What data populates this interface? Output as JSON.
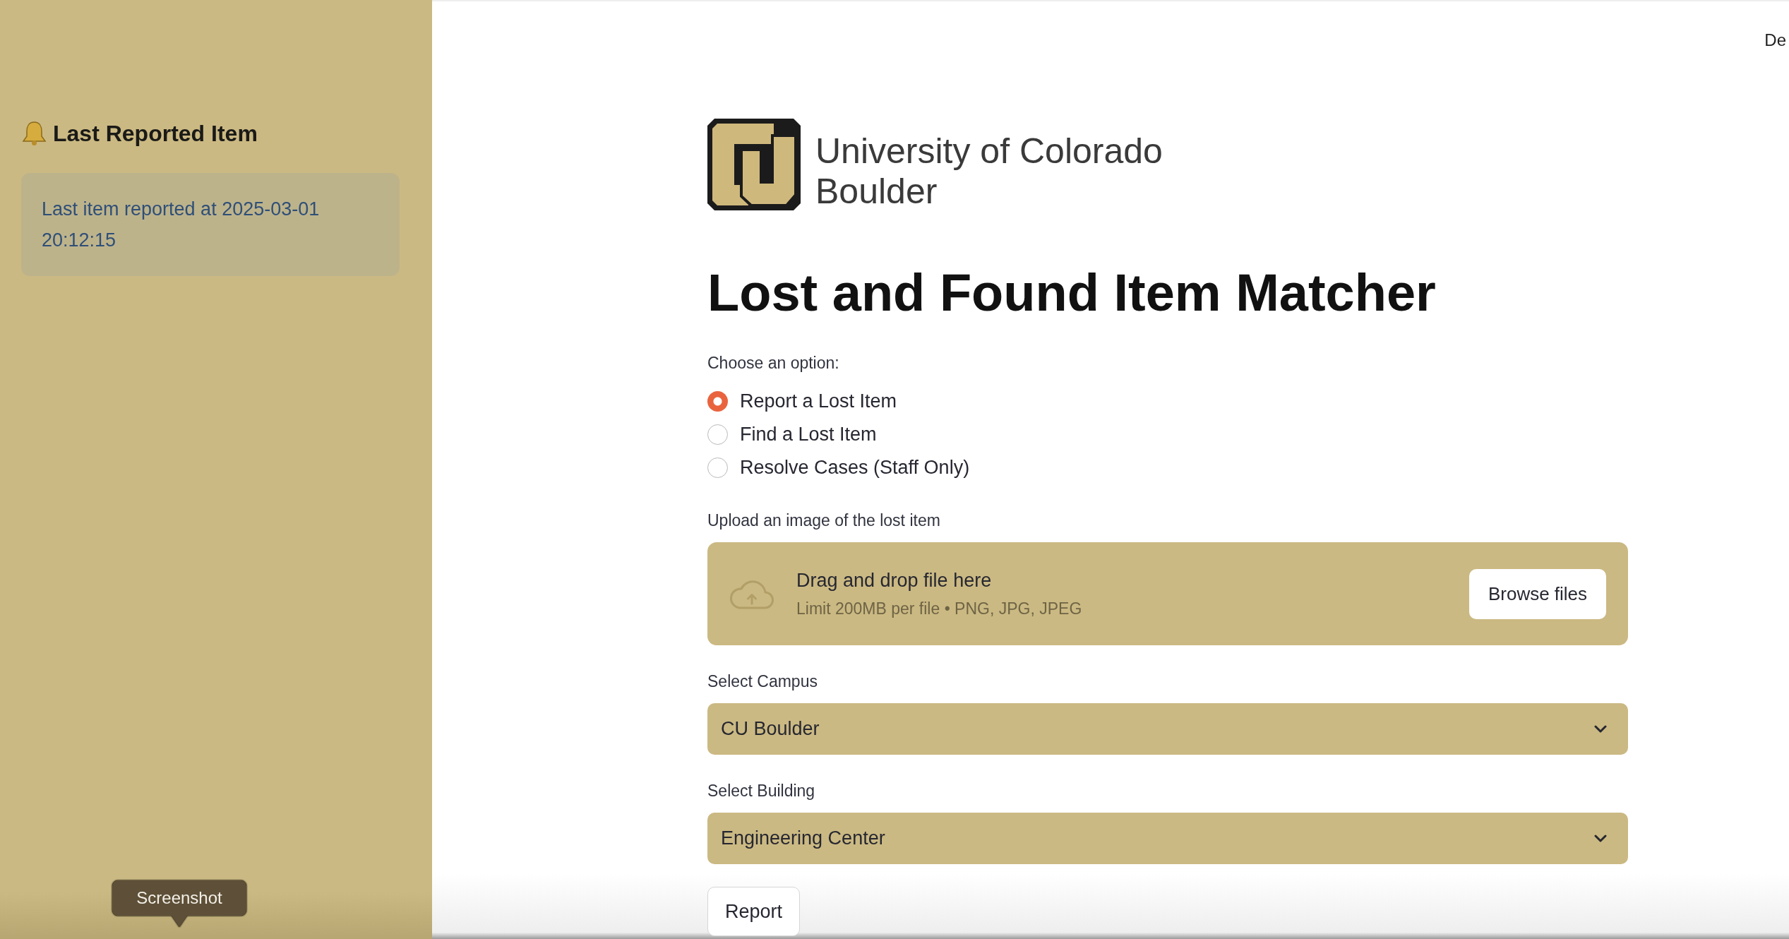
{
  "sidebar": {
    "title": "Last Reported Item",
    "info": "Last item reported at 2025-03-01 20:12:15"
  },
  "header": {
    "action_text": "De"
  },
  "logo": {
    "line_1": "University of Colorado",
    "line_2": "Boulder"
  },
  "title": "Lost and Found Item Matcher",
  "option_group": {
    "label": "Choose an option:",
    "options": [
      {
        "label": "Report a Lost Item",
        "selected": true
      },
      {
        "label": "Find a Lost Item",
        "selected": false
      },
      {
        "label": "Resolve Cases (Staff Only)",
        "selected": false
      }
    ]
  },
  "uploader": {
    "label": "Upload an image of the lost item",
    "prompt": "Drag and drop file here",
    "hint": "Limit 200MB per file • PNG, JPG, JPEG",
    "button": "Browse files"
  },
  "selects": [
    {
      "label": "Select Campus",
      "value": "CU Boulder"
    },
    {
      "label": "Select Building",
      "value": "Engineering Center"
    }
  ],
  "submit_button": "Report",
  "tooltip": "Screenshot"
}
